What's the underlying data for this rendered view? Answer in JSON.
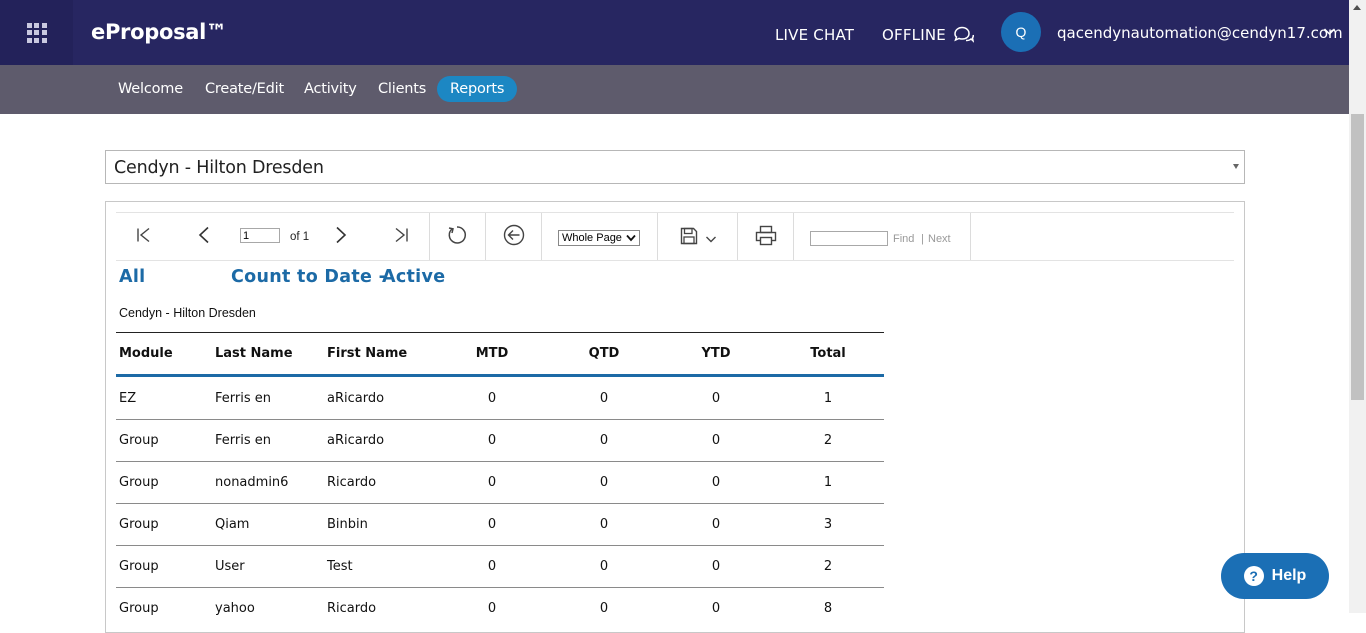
{
  "app": {
    "brand": "eProposal™"
  },
  "header": {
    "live_chat": "LIVE CHAT",
    "offline": "OFFLINE",
    "avatar_initial": "Q",
    "user_email": "qacendynautomation@cendyn17.com"
  },
  "nav": {
    "items": [
      {
        "label": "Welcome"
      },
      {
        "label": "Create/Edit"
      },
      {
        "label": "Activity"
      },
      {
        "label": "Clients"
      },
      {
        "label": "Reports",
        "active": true
      }
    ]
  },
  "hotel_select": {
    "value": "Cendyn - Hilton Dresden"
  },
  "viewer": {
    "page_current": "1",
    "page_of": "of 1",
    "zoom": "Whole Page",
    "find_label": "Find",
    "find_sep": "|",
    "next_label": "Next"
  },
  "report": {
    "filter_all": "All",
    "count_label": "Count to Date -",
    "status": "Active",
    "hotel": "Cendyn - Hilton Dresden",
    "columns": [
      "Module",
      "Last Name",
      "First Name",
      "MTD",
      "QTD",
      "YTD",
      "Total"
    ],
    "rows": [
      [
        "EZ",
        "Ferris en",
        "aRicardo",
        "0",
        "0",
        "0",
        "1"
      ],
      [
        "Group",
        "Ferris en",
        "aRicardo",
        "0",
        "0",
        "0",
        "2"
      ],
      [
        "Group",
        "nonadmin6",
        "Ricardo",
        "0",
        "0",
        "0",
        "1"
      ],
      [
        "Group",
        "Qiam",
        "Binbin",
        "0",
        "0",
        "0",
        "3"
      ],
      [
        "Group",
        "User",
        "Test",
        "0",
        "0",
        "0",
        "2"
      ],
      [
        "Group",
        "yahoo",
        "Ricardo",
        "0",
        "0",
        "0",
        "8"
      ]
    ]
  },
  "help": {
    "label": "Help"
  },
  "icons": [
    "apps-grid-icon",
    "chat-bubbles-icon",
    "chevron-down-icon",
    "first-page-icon",
    "previous-page-icon",
    "next-page-icon",
    "last-page-icon",
    "refresh-icon",
    "back-icon",
    "save-icon",
    "print-icon",
    "help-question-icon"
  ],
  "colors": {
    "header": "#272661",
    "subnav": "#5e5b6c",
    "accent": "#1c87c3",
    "report_title": "#1c6aa6",
    "help": "#1b6fb5"
  }
}
